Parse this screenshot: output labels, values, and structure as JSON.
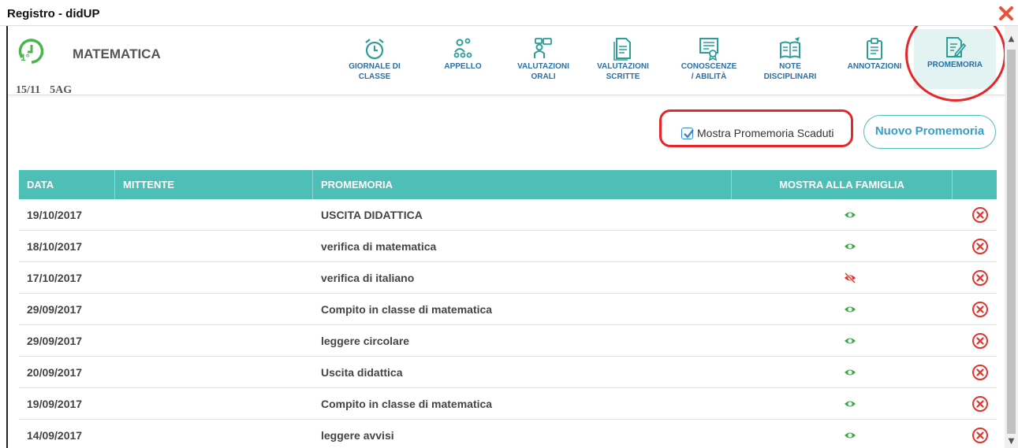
{
  "window": {
    "title": "Registro - didUP"
  },
  "header": {
    "subject": "MATEMATICA",
    "date": "15/11",
    "class": "5AG",
    "clock_badge": "1°"
  },
  "toolbar": [
    {
      "line1": "GIORNALE DI",
      "line2": "CLASSE",
      "icon": "alarm-clock-icon"
    },
    {
      "line1": "APPELLO",
      "line2": "",
      "icon": "people-icon"
    },
    {
      "line1": "VALUTAZIONI",
      "line2": "ORALI",
      "icon": "speech-person-icon"
    },
    {
      "line1": "VALUTAZIONI",
      "line2": "SCRITTE",
      "icon": "document-icon"
    },
    {
      "line1": "CONOSCENZE",
      "line2": "/ ABILITÀ",
      "icon": "certificate-icon"
    },
    {
      "line1": "NOTE",
      "line2": "DISCIPLINARI",
      "icon": "book-pen-icon"
    },
    {
      "line1": "ANNOTAZIONI",
      "line2": "",
      "icon": "clipboard-icon"
    },
    {
      "line1": "PROMEMORIA",
      "line2": "",
      "icon": "note-pen-icon"
    }
  ],
  "filter": {
    "show_expired_label": "Mostra Promemoria Scaduti",
    "show_expired_checked": true,
    "new_button": "Nuovo Promemoria"
  },
  "table": {
    "headers": [
      "DATA",
      "MITTENTE",
      "PROMEMORIA",
      "MOSTRA ALLA FAMIGLIA"
    ],
    "rows": [
      {
        "date": "19/10/2017",
        "sender": "",
        "text": "USCITA DIDATTICA",
        "visible": true
      },
      {
        "date": "18/10/2017",
        "sender": "",
        "text": "verifica di matematica",
        "visible": true
      },
      {
        "date": "17/10/2017",
        "sender": "",
        "text": "verifica di italiano",
        "visible": false
      },
      {
        "date": "29/09/2017",
        "sender": "",
        "text": "Compito in classe di matematica",
        "visible": true
      },
      {
        "date": "29/09/2017",
        "sender": "",
        "text": "leggere circolare",
        "visible": true
      },
      {
        "date": "20/09/2017",
        "sender": "",
        "text": "Uscita didattica",
        "visible": true
      },
      {
        "date": "19/09/2017",
        "sender": "",
        "text": "Compito in classe di matematica",
        "visible": true
      },
      {
        "date": "14/09/2017",
        "sender": "",
        "text": "leggere avvisi",
        "visible": true
      }
    ]
  },
  "colors": {
    "accent": "#4ebfb6",
    "label_blue": "#2b6fa3",
    "eye_green": "#3aa84a",
    "delete_red": "#e0352b",
    "highlight_red": "#e8262a"
  }
}
